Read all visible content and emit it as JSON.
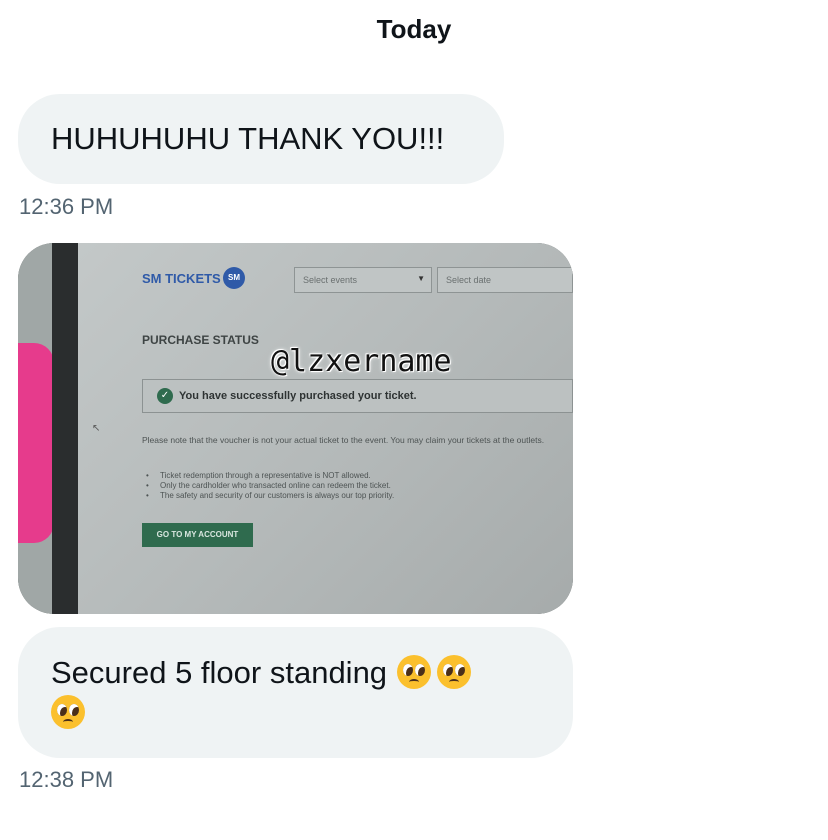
{
  "header": {
    "day": "Today"
  },
  "messages": [
    {
      "text": "HUHUHUHU THANK YOU!!!",
      "time": "12:36 PM"
    },
    {
      "text": "Secured 5 floor standing",
      "emoji": "pleading-face-emoji",
      "time": "12:38 PM"
    }
  ],
  "attachment": {
    "logo": "SM TICKETS",
    "logo_badge": "SM",
    "select_events": "Select events",
    "select_date": "Select date",
    "section_title": "PURCHASE STATUS",
    "success_message": "You have successfully purchased your ticket.",
    "note": "Please note that the voucher is not your actual ticket to the event. You may claim your tickets at the outlets.",
    "bullets": [
      "Ticket redemption through a representative is NOT allowed.",
      "Only the cardholder who transacted online can redeem the ticket.",
      "The safety and security of our customers is always our top priority."
    ],
    "button": "GO TO MY ACCOUNT",
    "watermark": "@lzxername"
  },
  "colors": {
    "bubble": "#eff3f4",
    "timestamp": "#536471",
    "accent": "#2f6b4e"
  }
}
